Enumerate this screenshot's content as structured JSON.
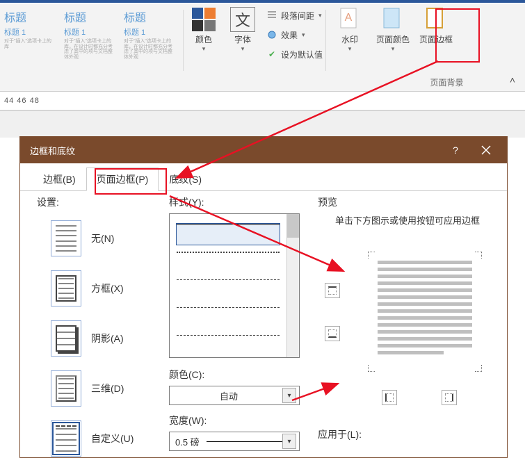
{
  "ribbon": {
    "styles": {
      "thumbs": [
        {
          "title": "标题",
          "sub": "标题 1",
          "lines": "对于\"插入\"选项卡上的库"
        },
        {
          "title": "标题",
          "sub": "标题 1",
          "lines": "对于\"插入\"选项卡上的库，在设计时都充分考虑了其中的项与文档整体外观"
        },
        {
          "title": "标题",
          "sub": "标题 1",
          "lines": "对于\"插入\"选项卡上的库，在设计时都充分考虑了其中的项与文档整体外观"
        }
      ]
    },
    "format": {
      "color_label": "颜色",
      "font_label": "字体",
      "para_spacing": "段落间距",
      "effects": "效果",
      "set_default": "设为默认值"
    },
    "background": {
      "watermark": "水印",
      "page_color": "页面颜色",
      "page_border": "页面边框",
      "group_label": "页面背景"
    }
  },
  "page_numbers": "44 46 48",
  "dialog": {
    "title": "边框和底纹",
    "help": "?",
    "tabs": {
      "borders": "边框(B)",
      "page_border": "页面边框(P)",
      "shading": "底纹(S)"
    },
    "settings_label": "设置:",
    "settings": {
      "none": "无(N)",
      "box": "方框(X)",
      "shadow": "阴影(A)",
      "threeD": "三维(D)",
      "custom": "自定义(U)"
    },
    "style_label": "样式(Y):",
    "color_label": "颜色(C):",
    "color_value": "自动",
    "width_label": "宽度(W):",
    "width_value": "0.5 磅",
    "preview_label": "预览",
    "preview_hint": "单击下方图示或使用按钮可应用边框",
    "apply_label": "应用于(L):"
  }
}
